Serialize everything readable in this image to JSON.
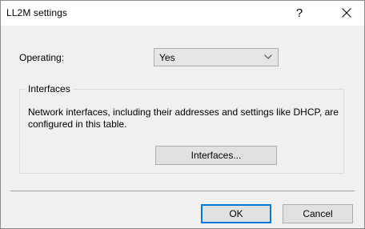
{
  "window": {
    "title": "LL2M settings",
    "help_label": "?",
    "close_icon": "close-icon"
  },
  "operating": {
    "label": "Operating:",
    "selected_value": "Yes",
    "arrow_icon": "chevron-down-icon"
  },
  "interfaces_group": {
    "title": "Interfaces",
    "description": "Network interfaces, including their addresses and settings like DHCP, are configured in this table.",
    "button_label": "Interfaces..."
  },
  "footer": {
    "ok_label": "OK",
    "cancel_label": "Cancel"
  },
  "colors": {
    "dialog_background": "#f0f0f0",
    "title_background": "#ffffff",
    "default_button_border": "#0078d7"
  }
}
